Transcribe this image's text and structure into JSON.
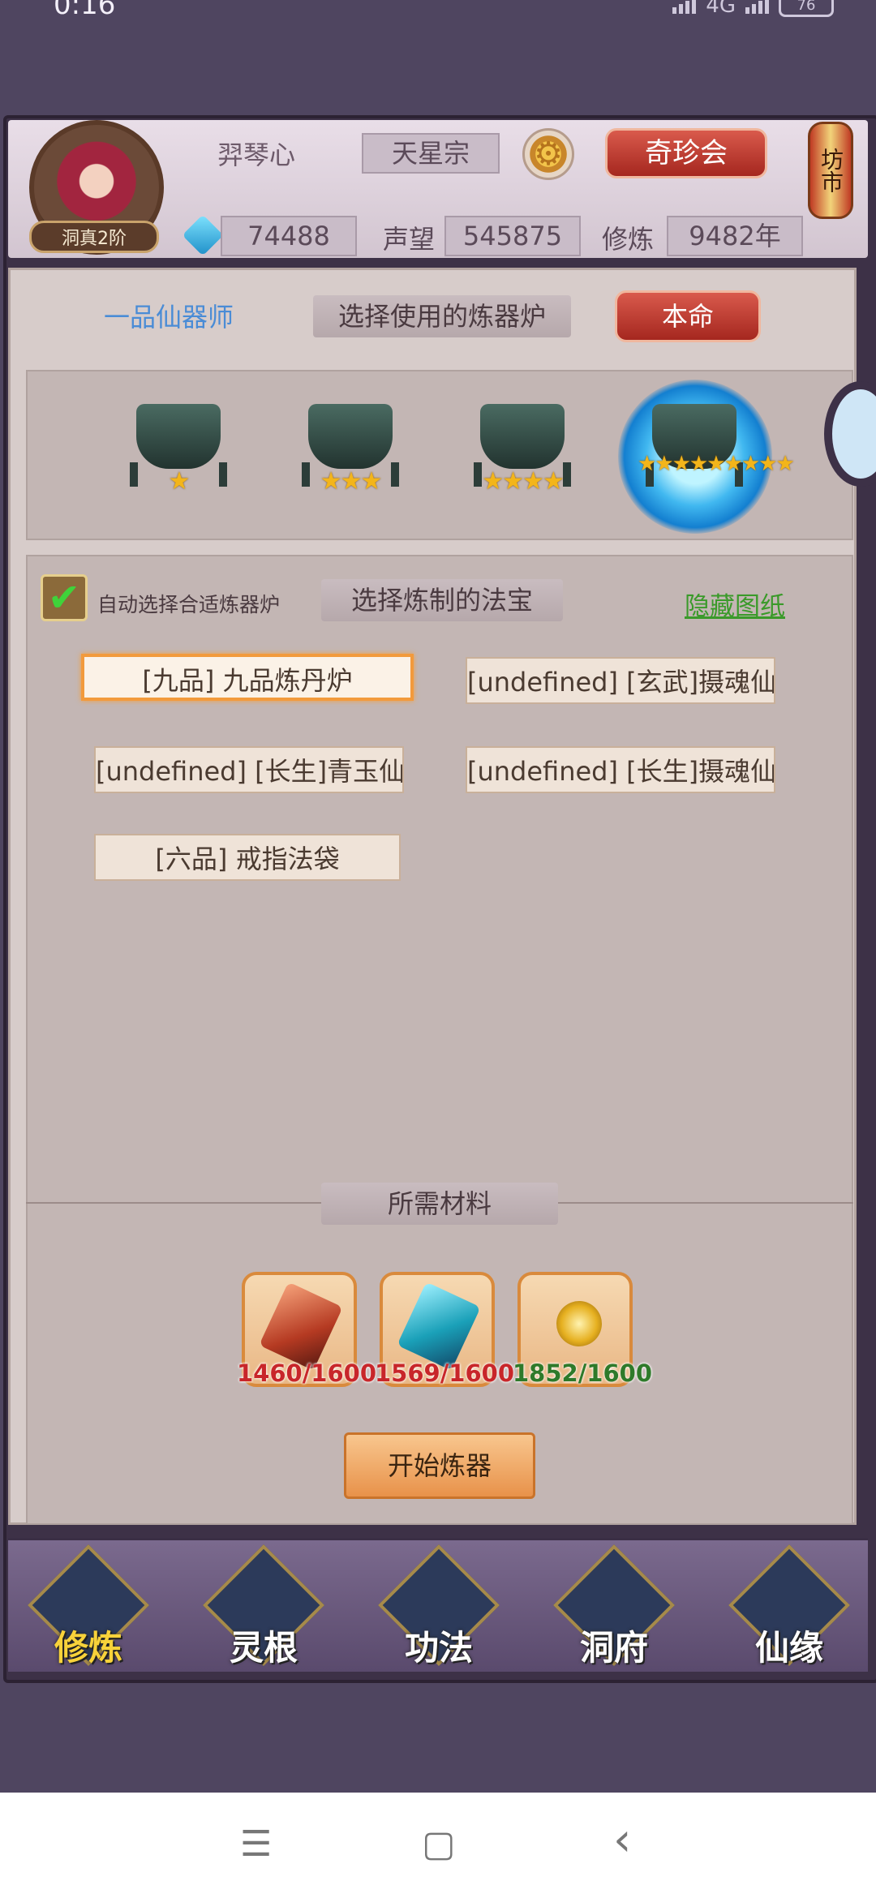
{
  "status_bar": {
    "time": "0:16",
    "network": "4G",
    "battery": "76"
  },
  "player": {
    "name": "羿琴心",
    "rank": "洞真2阶",
    "sect": "天星宗",
    "spirit_stones": "74488",
    "reputation_label": "声望",
    "reputation": "545875",
    "cultivation_label": "修炼",
    "cultivation": "9482年"
  },
  "header": {
    "treasure_fair_button": "奇珍会",
    "market_lantern": "坊市",
    "settings_icon": "gear-icon"
  },
  "forge": {
    "title": "一品仙器师",
    "furnace_banner": "选择使用的炼器炉",
    "benming_button": "本命",
    "furnaces": [
      {
        "stars": "★"
      },
      {
        "stars": "★★★"
      },
      {
        "stars": "★★★★"
      },
      {
        "stars": "★★★★★★★★★"
      }
    ],
    "auto_select_label": "自动选择合适炼器炉",
    "auto_select_checked": true,
    "treasure_banner": "选择炼制的法宝",
    "hide_link": "隐藏图纸",
    "items": [
      "[九品] 九品炼丹炉",
      "[undefined] [玄武]摄魂仙袍",
      "[undefined] [长生]青玉仙袍",
      "[undefined] [长生]摄魂仙袍",
      "[六品] 戒指法袋"
    ],
    "materials_banner": "所需材料",
    "materials": [
      {
        "count": "1460/1600",
        "color": "#c8262a"
      },
      {
        "count": "1569/1600",
        "color": "#c8262a"
      },
      {
        "count": "1852/1600",
        "color": "#2e7a2a"
      }
    ],
    "start_button": "开始炼器"
  },
  "bottom_nav": [
    "修炼",
    "灵根",
    "功法",
    "洞府",
    "仙缘"
  ],
  "system_nav": {
    "menu": "☰",
    "home": "▢",
    "back": "‹"
  }
}
